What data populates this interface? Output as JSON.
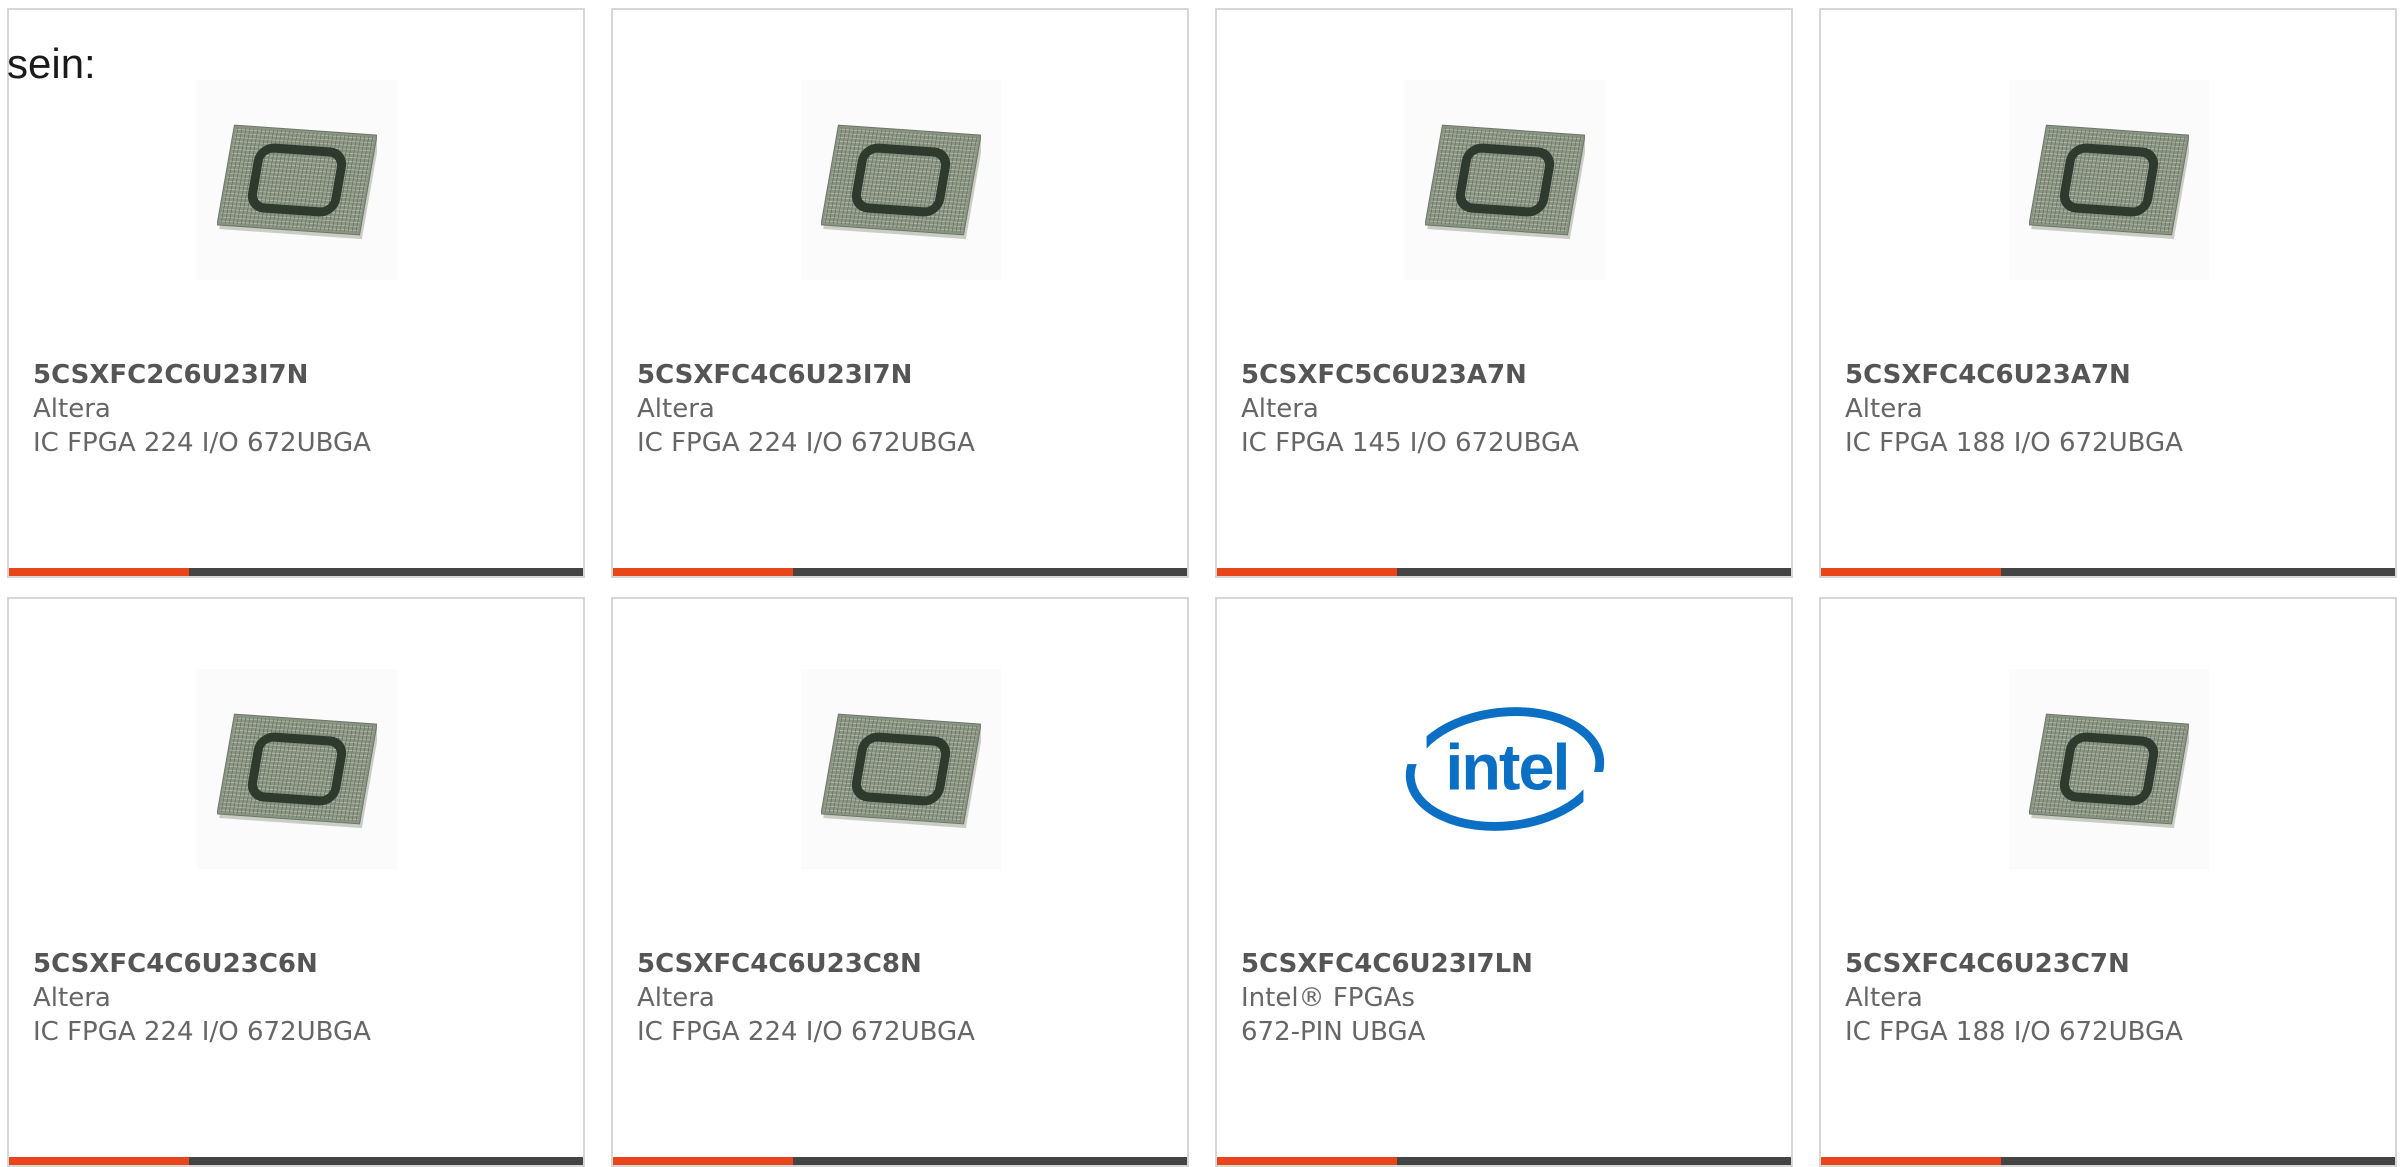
{
  "intro": {
    "text": "sein:"
  },
  "accent_color": "#e8461a",
  "bar_color": "#444444",
  "products": [
    {
      "part_number": "5CSXFC2C6U23I7N",
      "manufacturer": "Altera",
      "description": "IC FPGA 224 I/O 672UBGA",
      "image": "fpga-chip-icon"
    },
    {
      "part_number": "5CSXFC4C6U23I7N",
      "manufacturer": "Altera",
      "description": "IC FPGA 224 I/O 672UBGA",
      "image": "fpga-chip-icon"
    },
    {
      "part_number": "5CSXFC5C6U23A7N",
      "manufacturer": "Altera",
      "description": "IC FPGA 145 I/O 672UBGA",
      "image": "fpga-chip-icon"
    },
    {
      "part_number": "5CSXFC4C6U23A7N",
      "manufacturer": "Altera",
      "description": "IC FPGA 188 I/O 672UBGA",
      "image": "fpga-chip-icon"
    },
    {
      "part_number": "5CSXFC4C6U23C6N",
      "manufacturer": "Altera",
      "description": "IC FPGA 224 I/O 672UBGA",
      "image": "fpga-chip-icon"
    },
    {
      "part_number": "5CSXFC4C6U23C8N",
      "manufacturer": "Altera",
      "description": "IC FPGA 224 I/O 672UBGA",
      "image": "fpga-chip-icon"
    },
    {
      "part_number": "5CSXFC4C6U23I7LN",
      "manufacturer": "Intel® FPGAs",
      "description": "672-PIN UBGA",
      "image": "intel-logo",
      "logo_text": "intel"
    },
    {
      "part_number": "5CSXFC4C6U23C7N",
      "manufacturer": "Altera",
      "description": "IC FPGA 188 I/O 672UBGA",
      "image": "fpga-chip-icon"
    }
  ]
}
